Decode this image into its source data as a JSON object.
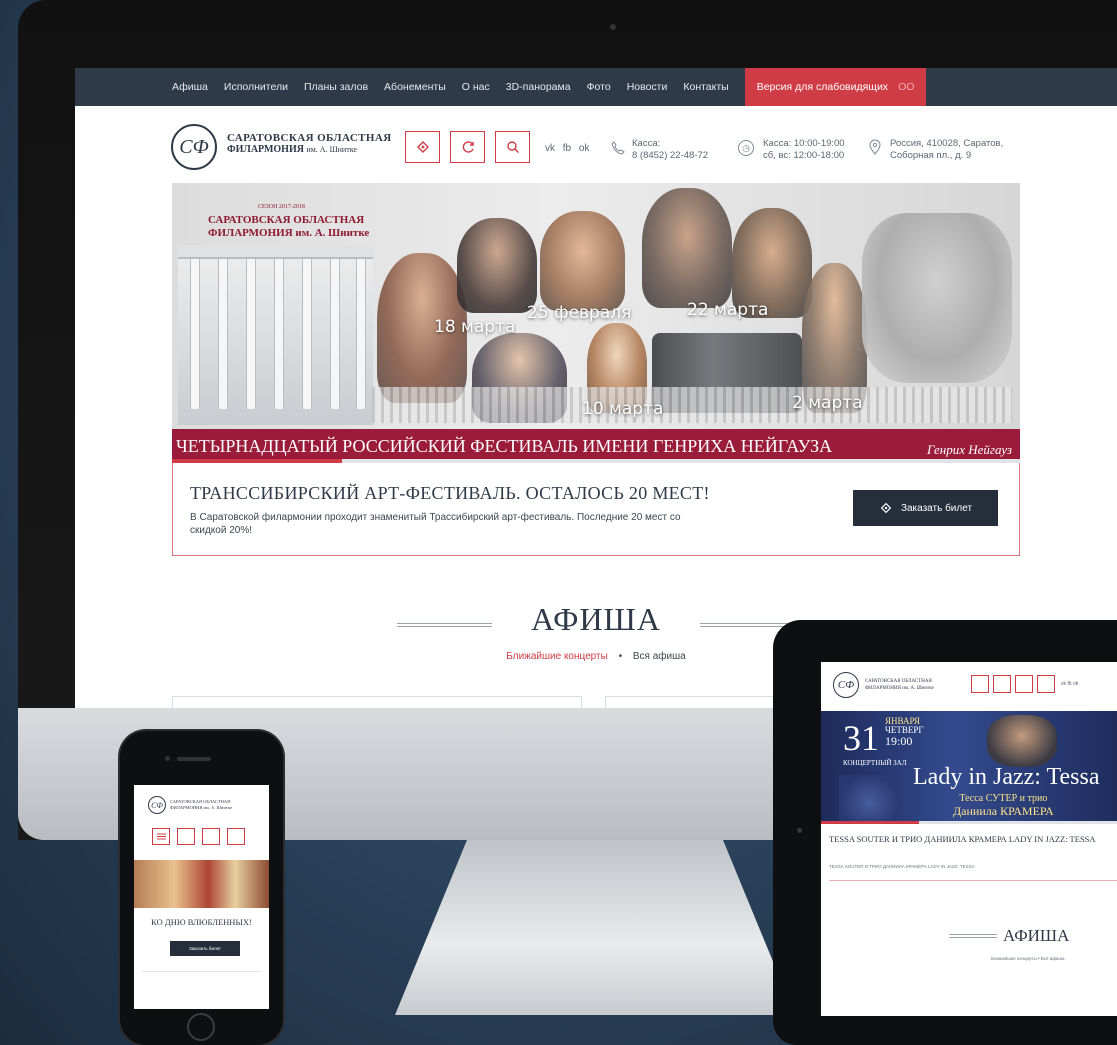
{
  "site": {
    "nav": [
      "Афиша",
      "Исполнители",
      "Планы залов",
      "Абонементы",
      "О нас",
      "3D-панорама",
      "Фото",
      "Новости",
      "Контакты"
    ],
    "impaired_label": "Версия для слабовидящих",
    "impaired_icon": "ОО",
    "logo_monogram": "СФ",
    "logo_line1": "САРАТОВСКАЯ ОБЛАСТНАЯ",
    "logo_line2": "ФИЛАРМОНИЯ",
    "logo_line2_small": "им. А. Шнитке",
    "social": "vk fb ok",
    "kassa_phone_label": "Касса:",
    "kassa_phone": "8 (8452) 22-48-72",
    "kassa_hours_1": "Касса: 10:00-19:00",
    "kassa_hours_2": "сб, вс: 12:00-18:00",
    "address_1": "Россия, 410028, Саратов,",
    "address_2": "Соборная пл., д. 9",
    "banner": {
      "logo_small": "СЕЗОН 2017-2018",
      "logo_main_1": "САРАТОВСКАЯ ОБЛАСТНАЯ",
      "logo_main_2": "ФИЛАРМОНИЯ им. А. Шнитке",
      "dates": [
        "18 марта",
        "25 февраля",
        "22 марта",
        "10 марта",
        "2 марта"
      ],
      "festival": "ЧЕТЫРНАДЦАТЫЙ РОССИЙСКИЙ ФЕСТИВАЛЬ ИМЕНИ ГЕНРИХА НЕЙГАУЗА",
      "signature": "Генрих Нейгауз"
    },
    "promo": {
      "title": "ТРАНССИБИРСКИЙ АРТ-ФЕСТИВАЛЬ. ОСТАЛОСЬ 20 МЕСТ!",
      "text": "В Саратовской филармонии проходит знаменитый Трассибирский арт-фестиваль. Последние 20 мест со скидкой 20%!",
      "button": "Заказать билет"
    },
    "afisha": {
      "title": "АФИША",
      "link_near": "Ближайшие концерты",
      "separator": "•",
      "link_all": "Вся афиша"
    }
  },
  "phone": {
    "logo_line1": "САРАТОВСКАЯ ОБЛАСТНАЯ",
    "logo_line2": "ФИЛАРМОНИЯ им. А. Шнитке",
    "caption": "КО ДНЮ ВЛЮБЛЕННЫХ!",
    "button": "Заказать билет"
  },
  "tablet": {
    "logo_line1": "САРАТОВСКАЯ ОБЛАСТНАЯ",
    "logo_line2": "ФИЛАРМОНИЯ им. А. Шнитке",
    "social": "vk fb ok",
    "day": "31",
    "month": "ЯНВАРЯ",
    "weekday": "ЧЕТВЕРГ",
    "time": "19:00",
    "hall": "КОНЦЕРТНЫЙ ЗАЛ",
    "headline": "Lady in Jazz: Tessa",
    "sub1": "Тесса СУТЕР и трио",
    "sub2": "Даниила КРАМЕРА",
    "caption": "TESSA SOUTER И ТРИО ДАНИИЛА КРАМЕРА LADY IN JAZZ: TESSA",
    "small": "TESSA SOUTER И ТРИО ДАНИИЛА КРАМЕРА LADY IN JAZZ: TESSA",
    "afisha": "АФИША",
    "links": "Ближайшие концерты • Вся афиша"
  },
  "colors": {
    "accent": "#d03c46",
    "dark": "#2e3a48",
    "festival": "#9b1c3a"
  }
}
